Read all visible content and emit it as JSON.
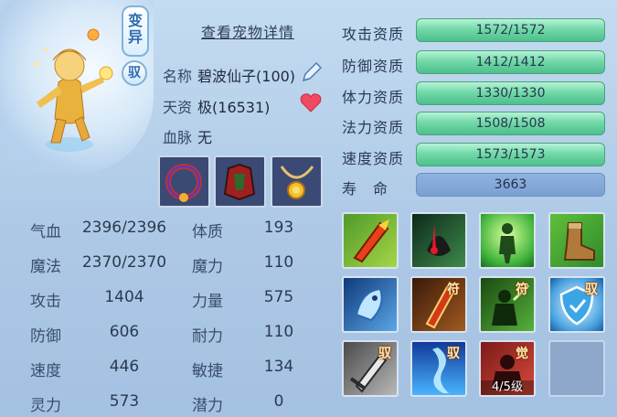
{
  "header": {
    "detail_link": "查看宠物详情",
    "badge_variant": "变异",
    "badge_tame": "驭"
  },
  "info": {
    "name_label": "名称",
    "name_value": "碧波仙子(100)",
    "talent_label": "天资",
    "talent_value": "极(16531)",
    "bloodline_label": "血脉",
    "bloodline_value": "无"
  },
  "stats": [
    {
      "label": "气血",
      "value": "2396/2396",
      "label2": "体质",
      "value2": "193"
    },
    {
      "label": "魔法",
      "value": "2370/2370",
      "label2": "魔力",
      "value2": "110"
    },
    {
      "label": "攻击",
      "value": "1404",
      "label2": "力量",
      "value2": "575"
    },
    {
      "label": "防御",
      "value": "606",
      "label2": "耐力",
      "value2": "110"
    },
    {
      "label": "速度",
      "value": "446",
      "label2": "敏捷",
      "value2": "134"
    },
    {
      "label": "灵力",
      "value": "573",
      "label2": "潜力",
      "value2": "0"
    }
  ],
  "aptitudes": [
    {
      "label": "攻击资质",
      "value": "1572/1572"
    },
    {
      "label": "防御资质",
      "value": "1412/1412"
    },
    {
      "label": "体力资质",
      "value": "1330/1330"
    },
    {
      "label": "法力资质",
      "value": "1508/1508"
    },
    {
      "label": "速度资质",
      "value": "1573/1573"
    }
  ],
  "life": {
    "label": "寿　命",
    "value": "3663"
  },
  "skills": [
    {
      "icon": "sword-strike-icon",
      "tag": ""
    },
    {
      "icon": "blood-drain-icon",
      "tag": ""
    },
    {
      "icon": "aura-figure-icon",
      "tag": ""
    },
    {
      "icon": "boot-icon",
      "tag": ""
    },
    {
      "icon": "frost-spirit-icon",
      "tag": ""
    },
    {
      "icon": "talisman-blade-icon",
      "tag": "符"
    },
    {
      "icon": "talisman-warrior-icon",
      "tag": "符"
    },
    {
      "icon": "shield-icon",
      "tag": "驭"
    },
    {
      "icon": "greatsword-icon",
      "tag": "驭"
    },
    {
      "icon": "water-pillar-icon",
      "tag": "驭"
    },
    {
      "icon": "awaken-icon",
      "tag": "觉",
      "level": "4/5级"
    }
  ]
}
